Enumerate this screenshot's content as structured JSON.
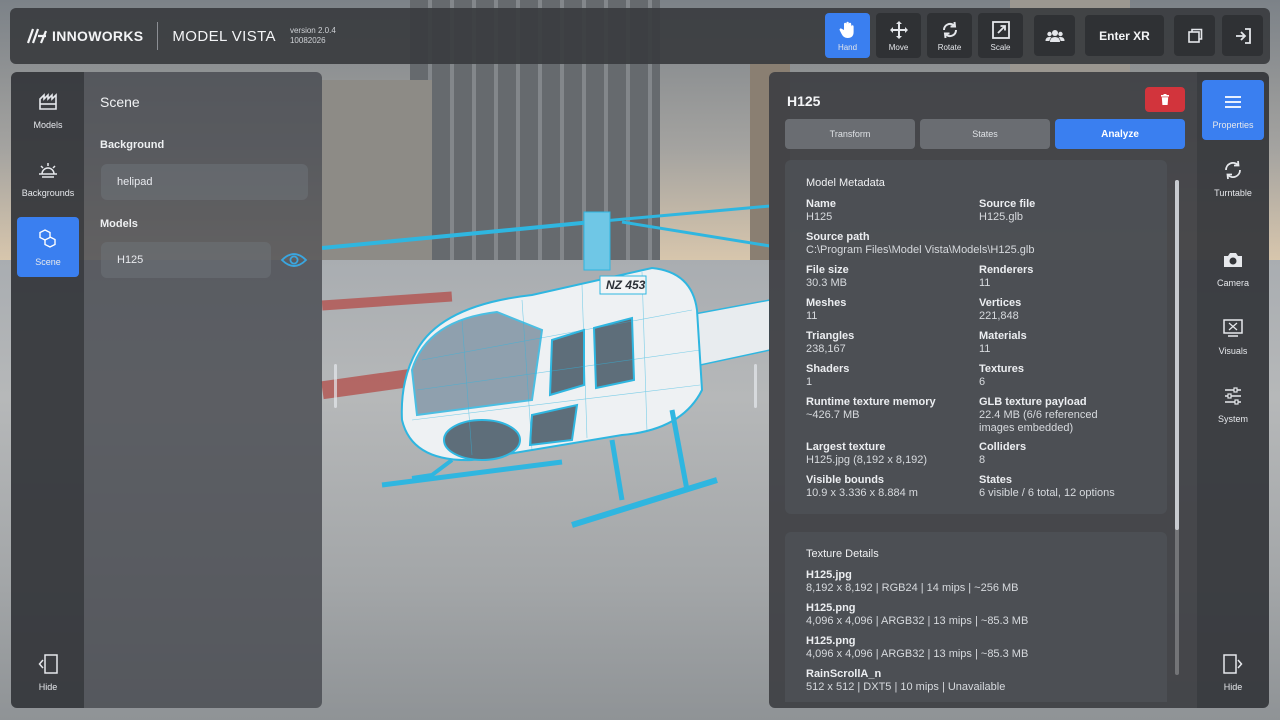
{
  "topbar": {
    "brand": "INNOWORKS",
    "app_name": "MODEL VISTA",
    "version_line1": "version 2.0.4",
    "version_line2": "10082026",
    "tools": [
      {
        "label": "Hand",
        "icon": "hand-icon",
        "active": true
      },
      {
        "label": "Move",
        "icon": "move-icon",
        "active": false
      },
      {
        "label": "Rotate",
        "icon": "rotate-icon",
        "active": false
      },
      {
        "label": "Scale",
        "icon": "scale-icon",
        "active": false
      }
    ],
    "enter_xr": "Enter XR",
    "accent": "#3a7ff0"
  },
  "left_rail": {
    "items": [
      {
        "label": "Models",
        "icon": "models-icon"
      },
      {
        "label": "Backgrounds",
        "icon": "backgrounds-icon"
      },
      {
        "label": "Scene",
        "icon": "scene-icon",
        "active": true
      }
    ],
    "hide": "Hide"
  },
  "scene_panel": {
    "title": "Scene",
    "background_label": "Background",
    "background_value": "helipad",
    "models_label": "Models",
    "model_item": "H125"
  },
  "viewport": {
    "tail_number": "NZ 453"
  },
  "properties": {
    "title": "H125",
    "delete_color": "#d2343c",
    "tabs": [
      {
        "label": "Transform"
      },
      {
        "label": "States"
      },
      {
        "label": "Analyze",
        "active": true
      }
    ],
    "metadata_title": "Model Metadata",
    "metadata": {
      "name_k": "Name",
      "name_v": "H125",
      "source_file_k": "Source file",
      "source_file_v": "H125.glb",
      "source_path_k": "Source path",
      "source_path_v": "C:\\Program Files\\Model Vista\\Models\\H125.glb",
      "file_size_k": "File size",
      "file_size_v": "30.3 MB",
      "renderers_k": "Renderers",
      "renderers_v": "11",
      "meshes_k": "Meshes",
      "meshes_v": "11",
      "vertices_k": "Vertices",
      "vertices_v": "221,848",
      "triangles_k": "Triangles",
      "triangles_v": "238,167",
      "materials_k": "Materials",
      "materials_v": "11",
      "shaders_k": "Shaders",
      "shaders_v": "1",
      "textures_k": "Textures",
      "textures_v": "6",
      "runtime_mem_k": "Runtime texture memory",
      "runtime_mem_v": "~426.7 MB",
      "glb_payload_k": "GLB texture payload",
      "glb_payload_v1": "22.4 MB (6/6 referenced",
      "glb_payload_v2": "images embedded)",
      "largest_tex_k": "Largest texture",
      "largest_tex_v": "H125.jpg (8,192 x 8,192)",
      "colliders_k": "Colliders",
      "colliders_v": "8",
      "bounds_k": "Visible bounds",
      "bounds_v": "10.9 x 3.336 x 8.884 m",
      "states_k": "States",
      "states_v": "6 visible / 6 total, 12 options"
    },
    "texture_title": "Texture Details",
    "textures": [
      {
        "name": "H125.jpg",
        "detail": "8,192 x 8,192 | RGB24 | 14 mips | ~256 MB"
      },
      {
        "name": "H125.png",
        "detail": "4,096 x 4,096 | ARGB32 | 13 mips | ~85.3 MB"
      },
      {
        "name": "H125.png",
        "detail": "4,096 x 4,096 | ARGB32 | 13 mips | ~85.3 MB"
      },
      {
        "name": "RainScrollA_n",
        "detail": "512 x 512 | DXT5 | 10 mips | Unavailable"
      }
    ]
  },
  "right_rail": {
    "items": [
      {
        "label": "Properties",
        "icon": "properties-icon",
        "active": true
      },
      {
        "label": "Turntable",
        "icon": "turntable-icon"
      },
      {
        "label": "Camera",
        "icon": "camera-icon"
      },
      {
        "label": "Visuals",
        "icon": "visuals-icon"
      },
      {
        "label": "System",
        "icon": "system-icon"
      }
    ],
    "hide": "Hide"
  }
}
